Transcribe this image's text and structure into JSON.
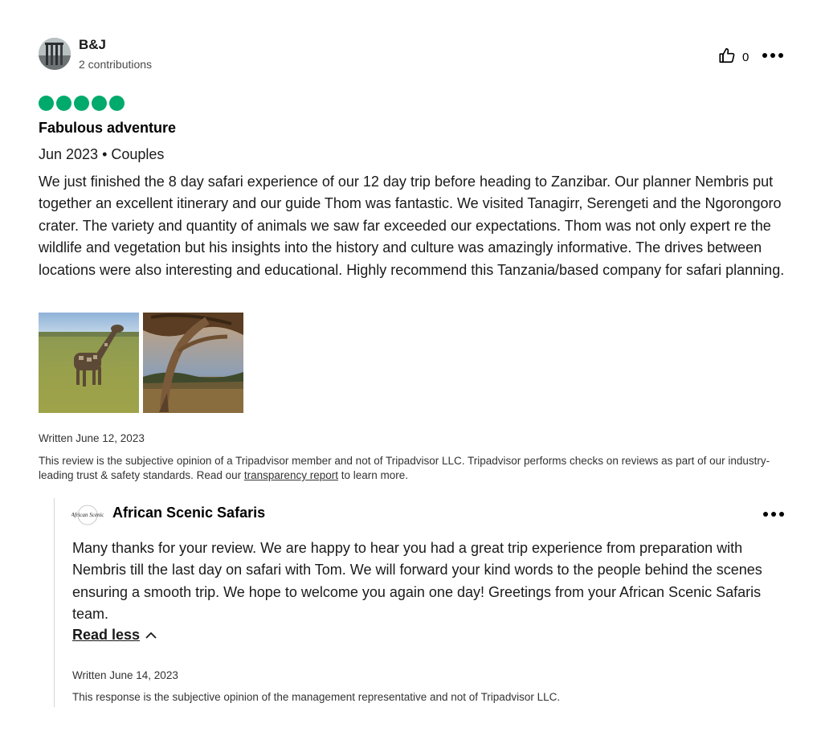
{
  "review": {
    "author": "B&J",
    "contributions": "2 contributions",
    "helpful_count": "0",
    "rating": 5,
    "rating_color": "#00aa6c",
    "title": "Fabulous adventure",
    "meta": "Jun 2023 • Couples",
    "body": "We just finished the 8 day safari experience of our 12 day trip before heading to Zanzibar. Our planner Nembris put together an excellent itinerary and our guide Thom was fantastic. We visited Tanagirr, Serengeti and the Ngorongoro crater. The variety and quantity of animals we saw far exceeded our expectations. Thom was not only expert re the wildlife and vegetation but his insights into the history and culture was amazingly informative. The drives between locations were also interesting and educational. Highly recommend this Tanzania/based company for safari planning.",
    "photos": [
      "giraffe-photo",
      "acacia-tree-photo"
    ],
    "written_date": "Written June 12, 2023",
    "disclaimer_prefix": "This review is the subjective opinion of a Tripadvisor member and not of Tripadvisor LLC. Tripadvisor performs checks on reviews as part of our industry-leading trust & safety standards. Read our ",
    "disclaimer_link": "transparency report",
    "disclaimer_suffix": " to learn more."
  },
  "response": {
    "business_name": "African Scenic Safaris",
    "logo_text": "African Scenic",
    "body": "Many thanks for your review. We are happy to hear you had a great trip experience from preparation with Nembris till the last day on safari with Tom. We will forward your kind words to the people behind the scenes ensuring a smooth trip. We hope to welcome you again one day! Greetings from your African Scenic Safaris team.",
    "read_less_label": "Read less",
    "written_date": "Written June 14, 2023",
    "disclaimer": "This response is the subjective opinion of the management representative and not of Tripadvisor LLC."
  },
  "icons": {
    "helpful": "thumbs-up-icon",
    "more": "more-options-icon",
    "chevron": "chevron-up-icon"
  }
}
